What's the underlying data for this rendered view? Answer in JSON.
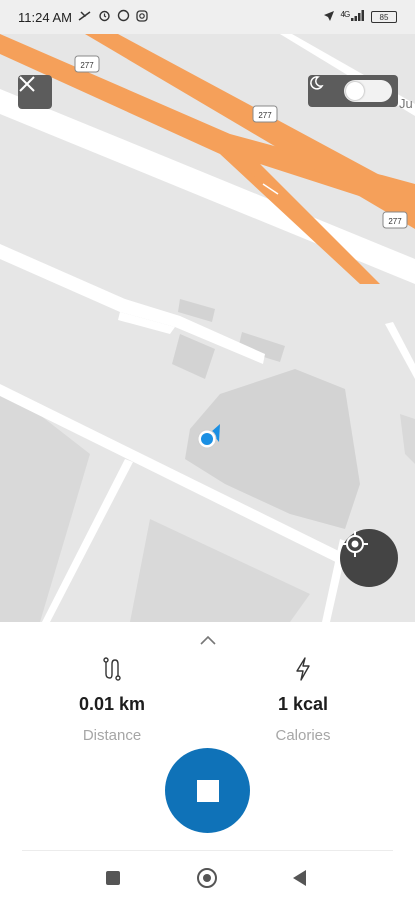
{
  "status_bar": {
    "time": "11:24 AM",
    "left_icons": [
      "missed-call-icon",
      "alarm-icon",
      "whatsapp-icon",
      "instagram-icon"
    ],
    "right_icons": [
      "location-arrow-icon",
      "signal-icon",
      "battery-icon"
    ],
    "network_label": "4G",
    "battery_level": "85"
  },
  "map": {
    "route_shields": [
      "277",
      "277",
      "277"
    ],
    "street_label_partial": "Ju",
    "colors": {
      "highway": "#f5a05a",
      "road": "#ffffff",
      "land": "#e6e6e6",
      "building": "#d6d6d6",
      "location_dot": "#1a8fe3"
    }
  },
  "controls": {
    "close_icon": "close-icon",
    "dark_mode_icon": "moon-icon",
    "dark_mode_enabled": false,
    "locate_icon": "crosshair-icon"
  },
  "stats": {
    "distance": {
      "value": "0.01 km",
      "label": "Distance",
      "icon": "route-icon"
    },
    "calories": {
      "value": "1 kcal",
      "label": "Calories",
      "icon": "lightning-icon"
    }
  },
  "actions": {
    "stop_icon": "stop-icon",
    "accent": "#0f72b8"
  },
  "nav": {
    "icons": [
      "recents-icon",
      "home-icon",
      "back-icon"
    ]
  }
}
